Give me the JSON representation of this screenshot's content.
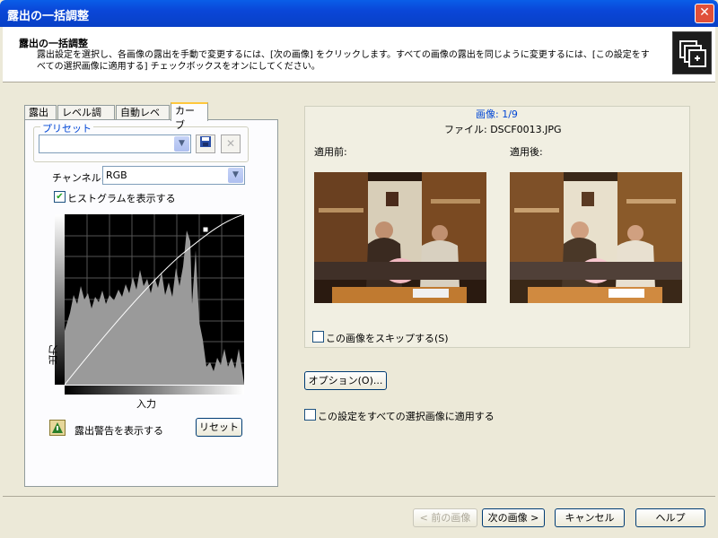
{
  "window": {
    "title": "露出の一括調整",
    "close_label": "✕"
  },
  "header": {
    "title": "露出の一括調整",
    "description": "露出設定を選択し、各画像の露出を手動で変更するには、[次の画像] をクリックします。すべての画像の露出を同じように変更するには、[この設定をすべての選択画像に適用する] チェックボックスをオンにしてください。"
  },
  "tabs": [
    "露出",
    "レベル調整",
    "自動レベル",
    "カーブ"
  ],
  "active_tab": "カーブ",
  "preset": {
    "legend": "プリセット",
    "value": "",
    "save_icon": "floppy-disk-icon",
    "delete_icon": "delete-x-icon"
  },
  "channel": {
    "label": "チャンネル:",
    "value": "RGB"
  },
  "histogram_checkbox": {
    "label": "ヒストグラムを表示する",
    "checked": true
  },
  "curve": {
    "x_label": "入力",
    "y_label": "出力"
  },
  "exposure_warning": {
    "label": "露出警告を表示する"
  },
  "reset_button": "リセット",
  "image_info": {
    "counter": "画像: 1/9",
    "file": "ファイル: DSCF0013.JPG"
  },
  "preview": {
    "before_label": "適用前:",
    "after_label": "適用後:"
  },
  "skip_checkbox": {
    "label": "この画像をスキップする(S)",
    "checked": false
  },
  "options_button": "オプション(O)...",
  "apply_all_checkbox": {
    "label": "この設定をすべての選択画像に適用する",
    "checked": false
  },
  "footer": {
    "prev_button": "< 前の画像",
    "next_button": "次の画像 >",
    "cancel_button": "キャンセル",
    "help_button": "ヘルプ"
  },
  "colors": {
    "title_bar": "#0a46d8",
    "dialog_bg": "#ece9d8",
    "link_blue": "#0046d5"
  }
}
